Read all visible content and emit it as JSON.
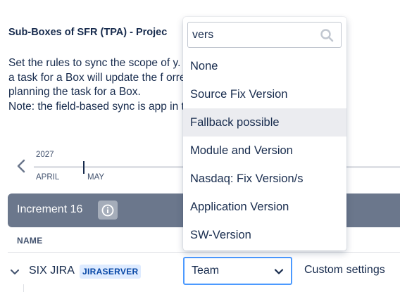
{
  "section": {
    "title": "Sub-Boxes of SFR (TPA) - Projec"
  },
  "description": {
    "line1": "Set the rules to sync the scope of                              y. The scop",
    "line2": "a task for a Box will update the f                              orrespond",
    "line3": "planning the task for a Box.",
    "line4": "Note: the field-based sync is app                              in the scop"
  },
  "timeline": {
    "year": "2027",
    "months": [
      "APRIL",
      "MAY"
    ]
  },
  "increment": {
    "title": "Increment 16"
  },
  "table": {
    "column_name": "NAME",
    "row": {
      "name": "SIX JIRA",
      "badge": "JIRASERVER",
      "team_value": "Team",
      "custom_settings": "Custom settings"
    }
  },
  "dropdown": {
    "search_value": "vers",
    "options": [
      "None",
      "Source Fix Version",
      "Fallback possible",
      "Module and Version",
      "Nasdaq: Fix Version/s",
      "Application Version",
      "SW-Version"
    ],
    "hovered_index": 2
  },
  "colors": {
    "increment_bar": "#6b778c",
    "focus_border": "#4c9aff",
    "badge_bg": "#deebff",
    "badge_text": "#0747a6",
    "option_hover": "#ebecf0"
  }
}
